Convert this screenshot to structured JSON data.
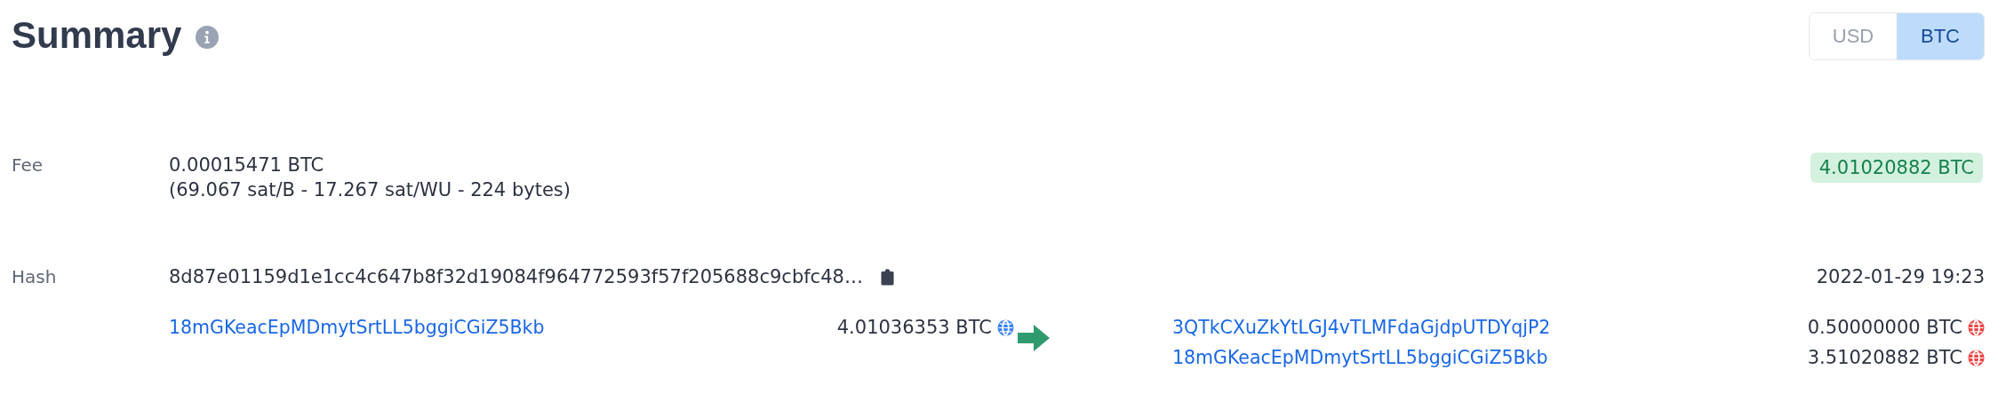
{
  "title": "Summary",
  "currency_toggle": [
    {
      "label": "USD",
      "selected": false
    },
    {
      "label": "BTC",
      "selected": true
    }
  ],
  "fee": {
    "label": "Fee",
    "amount": "0.00015471 BTC",
    "detail": "(69.067 sat/B - 17.267 sat/WU - 224 bytes)"
  },
  "total": "4.01020882 BTC",
  "hash": {
    "label": "Hash",
    "value": "8d87e01159d1e1cc4c647b8f32d19084f964772593f57f205688c9cbfc48…",
    "time": "2022-01-29 19:23"
  },
  "inputs": [
    {
      "address": "18mGKeacEpMDmytSrtLL5bggiCGiZ5Bkb",
      "amount": "4.01036353 BTC",
      "color": "#3b82f6"
    }
  ],
  "outputs": [
    {
      "address": "3QTkCXuZkYtLGJ4vTLMFdaGjdpUTDYqjP2",
      "amount": "0.50000000 BTC",
      "color": "#ef4444"
    },
    {
      "address": "18mGKeacEpMDmytSrtLL5bggiCGiZ5Bkb",
      "amount": "3.51020882 BTC",
      "color": "#ef4444"
    }
  ]
}
